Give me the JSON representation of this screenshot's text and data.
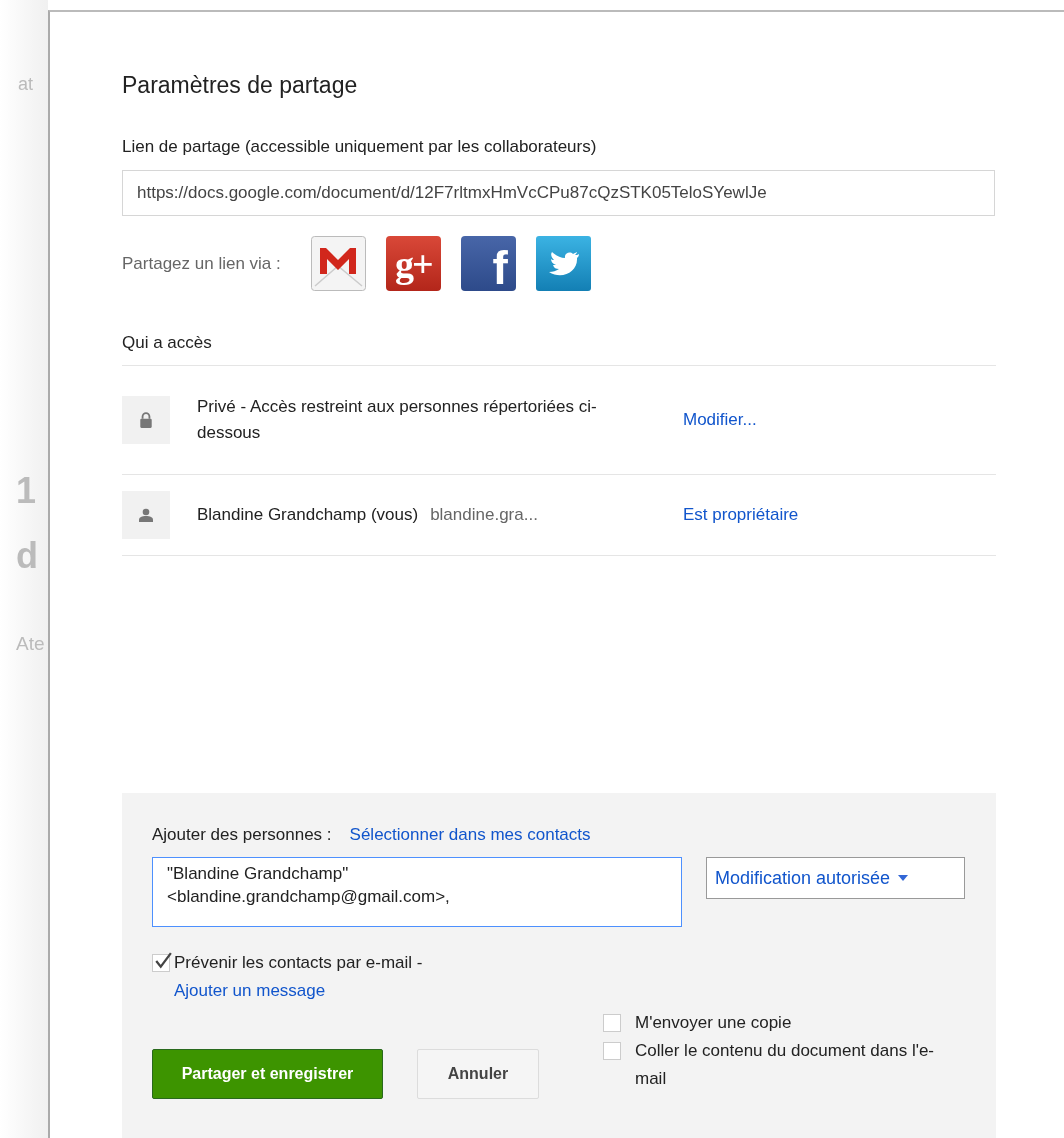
{
  "background_page": {
    "fragments": [
      "at",
      "1",
      "d",
      "Ate"
    ]
  },
  "dialog": {
    "title": "Paramètres de partage",
    "link_label": "Lien de partage (accessible uniquement par les collaborateurs)",
    "link_url": "https://docs.google.com/document/d/12F7rltmxHmVcCPu87cQzSTK05TeloSYewlJe",
    "share_label": "Partagez un lien via :",
    "share_services": [
      {
        "kind": "gmail"
      },
      {
        "kind": "gplus",
        "glyph": "g+"
      },
      {
        "kind": "facebook",
        "glyph": "f"
      },
      {
        "kind": "twitter"
      }
    ],
    "access": {
      "heading": "Qui a accès",
      "entries": [
        {
          "kind": "lock",
          "text": "Privé - Accès restreint aux personnes répertoriées ci-dessous",
          "link": "Modifier..."
        },
        {
          "kind": "person",
          "text": "Blandine Grandchamp (vous)",
          "email": "blandine.gra...",
          "link": "Est propriétaire"
        }
      ]
    },
    "add_people": {
      "label": "Ajouter des personnes :",
      "contacts_link": "Sélectionner dans mes contacts",
      "value": "\"Blandine Grandchamp\" <blandine.grandchamp@gmail.com>, ",
      "permission": "Modification autorisée",
      "notify": {
        "checked": true,
        "text": "Prévenir les contacts par e-mail - ",
        "link": "Ajouter un message"
      },
      "options": [
        {
          "label": "M'envoyer une copie",
          "checked": false
        },
        {
          "label": "Coller le contenu du document dans l'e-mail",
          "checked": false
        }
      ],
      "buttons": [
        {
          "kind": "primary",
          "label": "Partager et enregistrer"
        },
        {
          "kind": "secondary",
          "label": "Annuler"
        }
      ]
    }
  }
}
